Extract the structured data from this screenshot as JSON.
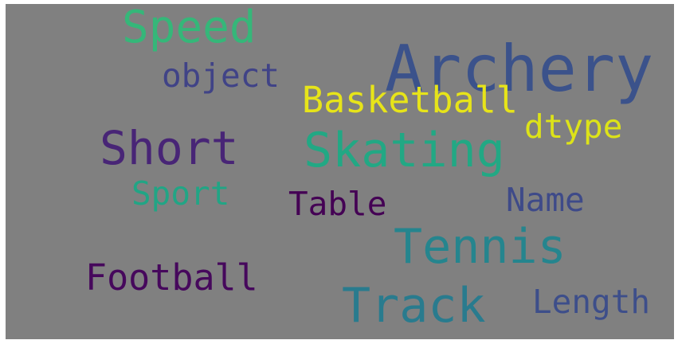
{
  "background_color": "#808080",
  "words": [
    {
      "id": "w-archery",
      "name": "word-archery",
      "text": "Archery",
      "color": "#3b528b"
    },
    {
      "id": "w-speed",
      "name": "word-speed",
      "text": "Speed",
      "color": "#35b779"
    },
    {
      "id": "w-object",
      "name": "word-object",
      "text": "object",
      "color": "#404387"
    },
    {
      "id": "w-basketball",
      "name": "word-basketball",
      "text": "Basketball",
      "color": "#e7e419"
    },
    {
      "id": "w-dtype",
      "name": "word-dtype",
      "text": "dtype",
      "color": "#dde318"
    },
    {
      "id": "w-short",
      "name": "word-short",
      "text": "Short",
      "color": "#482576"
    },
    {
      "id": "w-skating",
      "name": "word-skating",
      "text": "Skating",
      "color": "#22a884"
    },
    {
      "id": "w-sport",
      "name": "word-sport",
      "text": "Sport",
      "color": "#21a585"
    },
    {
      "id": "w-table",
      "name": "word-table",
      "text": "Table",
      "color": "#440154"
    },
    {
      "id": "w-name",
      "name": "word-name",
      "text": "Name",
      "color": "#3e4a89"
    },
    {
      "id": "w-tennis",
      "name": "word-tennis",
      "text": "Tennis",
      "color": "#25858e"
    },
    {
      "id": "w-football",
      "name": "word-football",
      "text": "Football",
      "color": "#46085c"
    },
    {
      "id": "w-track",
      "name": "word-track",
      "text": "Track",
      "color": "#297b8e"
    },
    {
      "id": "w-length",
      "name": "word-length",
      "text": "Length",
      "color": "#3d4e8a"
    }
  ]
}
